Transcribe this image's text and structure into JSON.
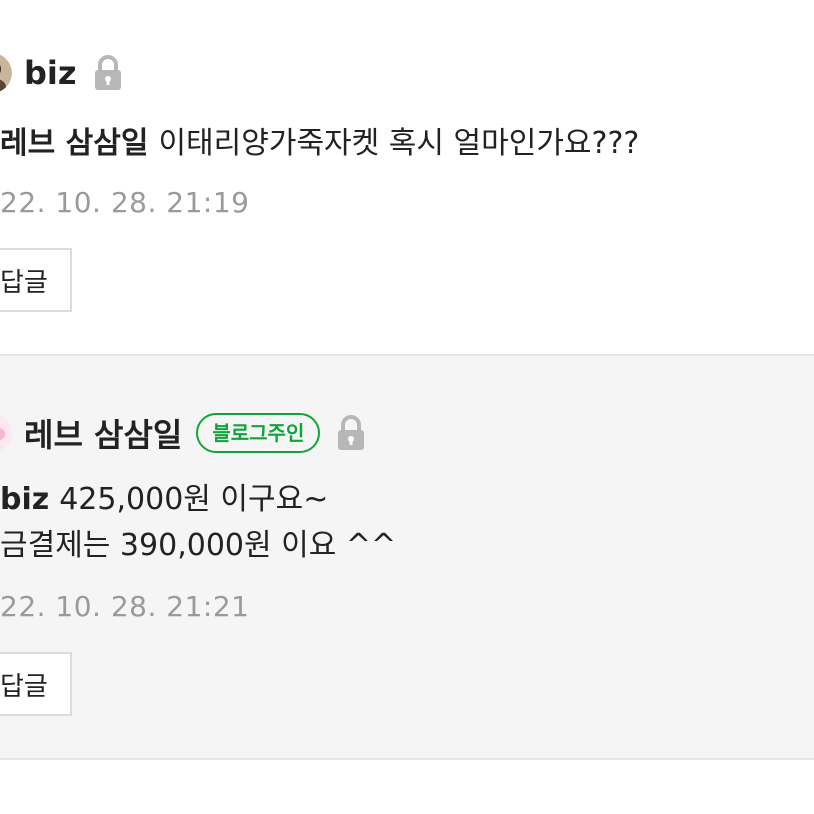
{
  "comments": [
    {
      "author": "biz",
      "mention": "레브 삼삼일",
      "lines": [
        "이태리양가죽자켓 혹시 얼마인가요???"
      ],
      "timestamp": "22. 10. 28. 21:19",
      "reply_label": "답글",
      "icons": [
        "avatar-photo",
        "lock-icon"
      ]
    },
    {
      "author": "레브 삼삼일",
      "badge": "블로그주인",
      "mention": "biz",
      "lines": [
        "425,000원 이구요~",
        "금결제는 390,000원 이요 ^^"
      ],
      "timestamp": "22. 10. 28. 21:21",
      "reply_label": "답글",
      "icons": [
        "avatar-flower",
        "lock-icon"
      ]
    }
  ],
  "colors": {
    "badge_green": "#12a33a",
    "timestamp_gray": "#9a9a9a",
    "reply_bg": "#f5f5f5"
  }
}
